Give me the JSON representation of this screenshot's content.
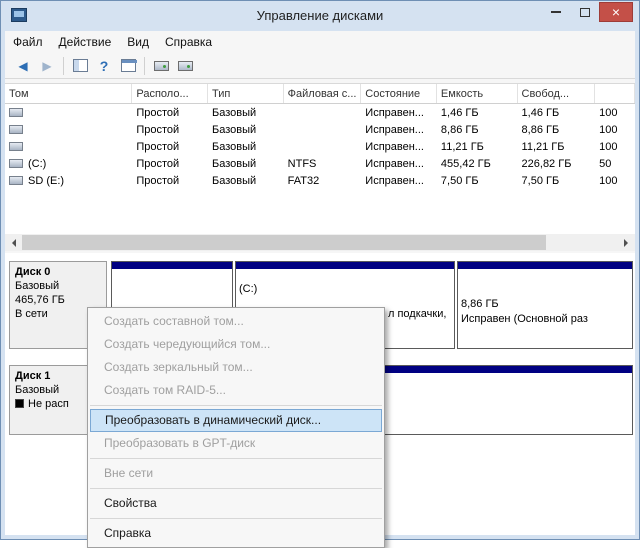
{
  "window": {
    "title": "Управление дисками",
    "controls": [
      "minimize-icon",
      "maximize-icon",
      "close-icon"
    ],
    "close_glyph": "×"
  },
  "menubar": {
    "items": [
      "Файл",
      "Действие",
      "Вид",
      "Справка"
    ]
  },
  "toolbar": {
    "icons": [
      "back-icon",
      "forward-icon",
      "console-tree-icon",
      "help-icon",
      "export-list-icon",
      "refresh-icon",
      "rescan-disks-icon"
    ],
    "help_glyph": "?"
  },
  "volume_list": {
    "columns": [
      "Том",
      "Располо...",
      "Тип",
      "Файловая с...",
      "Состояние",
      "Емкость",
      "Свобод...",
      ""
    ],
    "rows": [
      {
        "volume": "",
        "layout": "Простой",
        "type": "Базовый",
        "fs": "",
        "status": "Исправен...",
        "capacity": "1,46 ГБ",
        "free": "1,46 ГБ",
        "pct": "100"
      },
      {
        "volume": "",
        "layout": "Простой",
        "type": "Базовый",
        "fs": "",
        "status": "Исправен...",
        "capacity": "8,86 ГБ",
        "free": "8,86 ГБ",
        "pct": "100"
      },
      {
        "volume": "",
        "layout": "Простой",
        "type": "Базовый",
        "fs": "",
        "status": "Исправен...",
        "capacity": "11,21 ГБ",
        "free": "11,21 ГБ",
        "pct": "100"
      },
      {
        "volume": "(C:)",
        "layout": "Простой",
        "type": "Базовый",
        "fs": "NTFS",
        "status": "Исправен...",
        "capacity": "455,42 ГБ",
        "free": "226,82 ГБ",
        "pct": "50"
      },
      {
        "volume": "SD (E:)",
        "layout": "Простой",
        "type": "Базовый",
        "fs": "FAT32",
        "status": "Исправен...",
        "capacity": "7,50 ГБ",
        "free": "7,50 ГБ",
        "pct": "100"
      }
    ]
  },
  "graphical_view": {
    "disk0": {
      "name": "Диск 0",
      "type": "Базовый",
      "size": "465,76 ГБ",
      "status": "В сети",
      "partitions": [
        {
          "label": "",
          "size": "",
          "status": ""
        },
        {
          "label": "(C:)",
          "size": "",
          "status": "л подкачки,"
        },
        {
          "label": "",
          "size": "8,86 ГБ",
          "status": "Исправен (Основной раз"
        }
      ]
    },
    "disk1": {
      "name": "Диск 1",
      "type": "Базовый",
      "legend": "Не расп"
    }
  },
  "context_menu": {
    "items": [
      {
        "label": "Создать составной том...",
        "state": "disabled"
      },
      {
        "label": "Создать чередующийся том...",
        "state": "disabled"
      },
      {
        "label": "Создать зеркальный том...",
        "state": "disabled"
      },
      {
        "label": "Создать том RAID-5...",
        "state": "disabled"
      },
      {
        "separator": true
      },
      {
        "label": "Преобразовать в динамический диск...",
        "state": "highlighted"
      },
      {
        "label": "Преобразовать в GPT-диск",
        "state": "disabled"
      },
      {
        "separator": true
      },
      {
        "label": "Вне сети",
        "state": "disabled"
      },
      {
        "separator": true
      },
      {
        "label": "Свойства",
        "state": "normal"
      },
      {
        "separator": true
      },
      {
        "label": "Справка",
        "state": "normal"
      }
    ]
  },
  "colors": {
    "titlebar": "#d5e2f1",
    "partition_strip": "#000082",
    "close_button": "#c45048",
    "menu_highlight": "#cde4f7",
    "unallocated_legend": "#000000"
  }
}
